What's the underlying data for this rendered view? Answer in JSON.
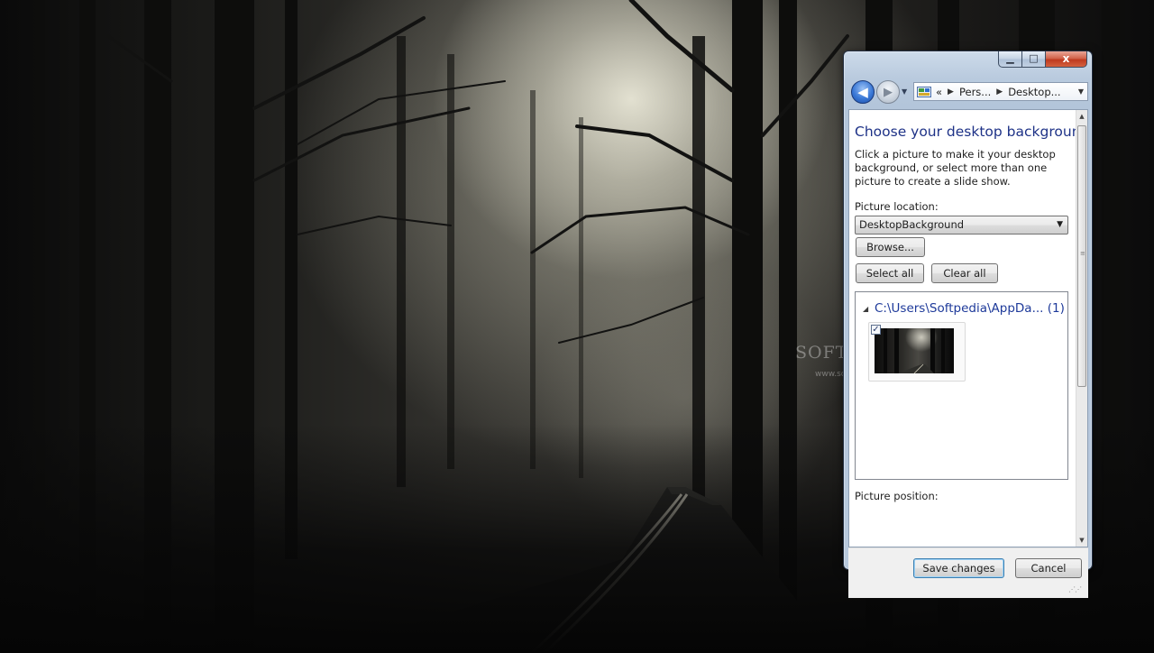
{
  "window": {
    "caption_buttons": {
      "minimize": "▁",
      "maximize": "□",
      "close": "x"
    },
    "nav": {
      "back_icon": "back-arrow-icon",
      "forward_icon": "forward-arrow-icon",
      "breadcrumb_prefix": "«",
      "breadcrumbs": [
        "Pers...",
        "Desktop..."
      ]
    },
    "content": {
      "title": "Choose your desktop background",
      "description": "Click a picture to make it your desktop background, or select more than one picture to create a slide show.",
      "picture_location_label": "Picture location:",
      "picture_location_value": "DesktopBackground",
      "browse_label": "Browse...",
      "select_all_label": "Select all",
      "clear_all_label": "Clear all",
      "group_header": "C:\\Users\\Softpedia\\AppDa... (1)",
      "thumbnail_checked": true,
      "picture_position_label": "Picture position:"
    },
    "footer": {
      "save_label": "Save changes",
      "cancel_label": "Cancel"
    }
  },
  "watermark": {
    "text": "SOFTPEDIA",
    "url": "www.softpedia.com"
  },
  "colors": {
    "title_blue": "#1e3287",
    "link_blue": "#1e3a9a",
    "close_red": "#c8462a"
  }
}
